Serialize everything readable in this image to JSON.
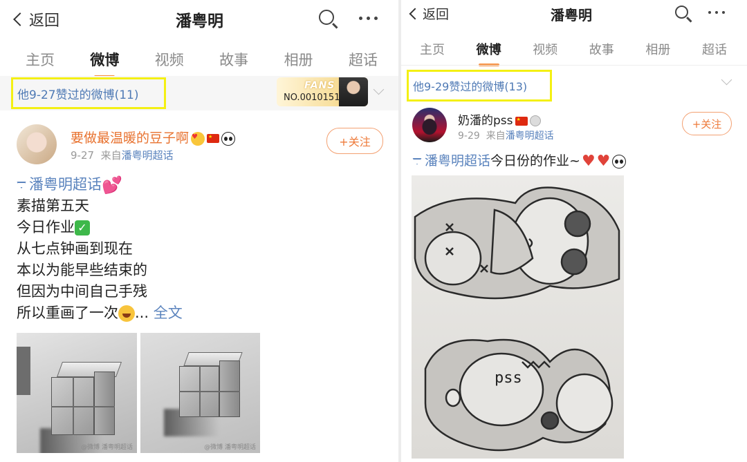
{
  "left": {
    "nav": {
      "back_label": "返回",
      "title": "潘粤明"
    },
    "tabs": [
      "主页",
      "微博",
      "视频",
      "故事",
      "相册",
      "超话"
    ],
    "active_tab": "微博",
    "liked_label": "他9-27赞过的微博(11)",
    "fans_badge": {
      "fans": "FANS",
      "number": "NO.0010151"
    },
    "post": {
      "username": "要做最温暖的豆子啊",
      "date": "9-27",
      "source_prefix": "来自",
      "source": "潘粤明超话",
      "follow_label": "+关注",
      "topic": "潘粤明超话",
      "lines": [
        "素描第五天",
        "今日作业",
        "从七点钟画到现在",
        "本以为能早些结束的",
        "但因为中间自己手残",
        "所以重画了一次"
      ],
      "ellipsis": "...",
      "more_label": "全文",
      "photo_watermark": "@微博  潘粤明超话"
    }
  },
  "right": {
    "nav": {
      "back_label": "返回",
      "title": "潘粤明"
    },
    "tabs": [
      "主页",
      "微博",
      "视频",
      "故事",
      "相册",
      "超话"
    ],
    "active_tab": "微博",
    "liked_label": "他9-29赞过的微博(13)",
    "post": {
      "username": "奶潘的pss",
      "date": "9-29",
      "source_prefix": "来自",
      "source": "潘粤明超话",
      "follow_label": "+关注",
      "topic": "潘粤明超话",
      "text": "今日份的作业~",
      "drawing_text": "pss"
    }
  },
  "colors": {
    "accent": "#f78c3a",
    "link": "#5a83bd",
    "highlight": "#f4f013",
    "follow": "#ee7a3a"
  },
  "icons": [
    "back-chevron-icon",
    "search-icon",
    "more-dots-icon",
    "chevron-down-icon",
    "flag-icon",
    "panda-icon",
    "heart-icon",
    "check-icon",
    "laugh-icon",
    "medal-icon",
    "supertopic-icon"
  ]
}
